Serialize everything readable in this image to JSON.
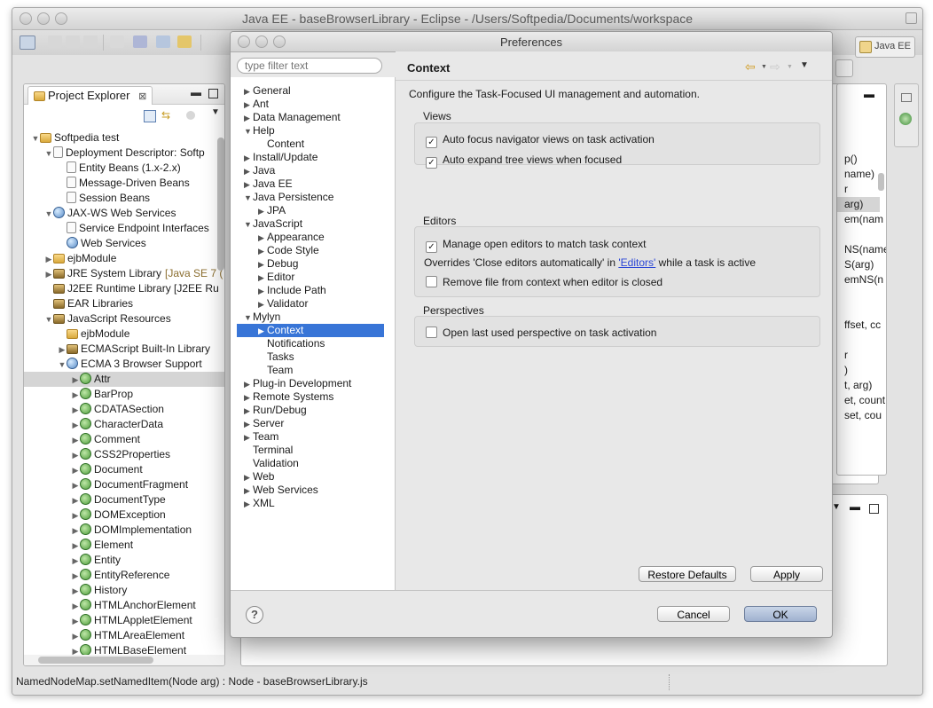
{
  "window": {
    "title": "Java EE - baseBrowserLibrary - Eclipse - /Users/Softpedia/Documents/workspace"
  },
  "perspective": {
    "label": "Java EE"
  },
  "explorer": {
    "tab_label": "Project Explorer",
    "rows": [
      {
        "label": "Softpedia test",
        "icon": "project-icon",
        "expanded": true
      },
      {
        "label": "Deployment Descriptor: Softp",
        "icon": "descriptor-icon",
        "expanded": true
      },
      {
        "label": "Entity Beans (1.x-2.x)",
        "icon": "beans-icon"
      },
      {
        "label": "Message-Driven Beans",
        "icon": "beans-icon"
      },
      {
        "label": "Session Beans",
        "icon": "beans-icon"
      },
      {
        "label": "JAX-WS Web Services",
        "icon": "webservice-icon",
        "expanded": true
      },
      {
        "label": "Service Endpoint Interfaces",
        "icon": "endpoint-icon"
      },
      {
        "label": "Web Services",
        "icon": "webservice-icon"
      },
      {
        "label": "ejbModule",
        "icon": "folder-icon",
        "expanded": false
      },
      {
        "label": "JRE System Library",
        "annotation": "[Java SE 7 (",
        "icon": "library-icon",
        "expanded": false
      },
      {
        "label": "J2EE Runtime Library [J2EE Ru",
        "icon": "library-icon"
      },
      {
        "label": "EAR Libraries",
        "icon": "library-icon"
      },
      {
        "label": "JavaScript Resources",
        "icon": "library-icon",
        "expanded": true
      },
      {
        "label": "ejbModule",
        "icon": "folder-icon"
      },
      {
        "label": "ECMAScript Built-In Library",
        "icon": "library-icon",
        "expanded": false
      },
      {
        "label": "ECMA 3 Browser Support",
        "icon": "globe-icon",
        "expanded": true
      },
      {
        "label": "Attr",
        "icon": "js-class-icon",
        "expanded": false
      },
      {
        "label": "BarProp",
        "icon": "js-class-icon",
        "expanded": false
      },
      {
        "label": "CDATASection",
        "icon": "js-class-icon",
        "expanded": false
      },
      {
        "label": "CharacterData",
        "icon": "js-class-icon",
        "expanded": false
      },
      {
        "label": "Comment",
        "icon": "js-class-icon",
        "expanded": false
      },
      {
        "label": "CSS2Properties",
        "icon": "js-class-icon",
        "expanded": false
      },
      {
        "label": "Document",
        "icon": "js-class-icon",
        "expanded": false
      },
      {
        "label": "DocumentFragment",
        "icon": "js-class-icon",
        "expanded": false
      },
      {
        "label": "DocumentType",
        "icon": "js-class-icon",
        "expanded": false
      },
      {
        "label": "DOMException",
        "icon": "js-class-icon",
        "expanded": false
      },
      {
        "label": "DOMImplementation",
        "icon": "js-class-icon",
        "expanded": false
      },
      {
        "label": "Element",
        "icon": "js-class-icon",
        "expanded": false
      },
      {
        "label": "Entity",
        "icon": "js-class-icon",
        "expanded": false
      },
      {
        "label": "EntityReference",
        "icon": "js-class-icon",
        "expanded": false
      },
      {
        "label": "History",
        "icon": "js-class-icon",
        "expanded": false
      },
      {
        "label": "HTMLAnchorElement",
        "icon": "js-class-icon",
        "expanded": false
      },
      {
        "label": "HTMLAppletElement",
        "icon": "js-class-icon",
        "expanded": false
      },
      {
        "label": "HTMLAreaElement",
        "icon": "js-class-icon",
        "expanded": false
      },
      {
        "label": "HTMLBaseElement",
        "icon": "js-class-icon",
        "expanded": false
      }
    ],
    "selected_label": "Attr"
  },
  "outline": {
    "fragments": [
      "p()",
      "name)",
      "r",
      "arg)",
      "em(nam",
      "",
      "NS(name",
      "S(arg)",
      "emNS(n",
      "",
      "",
      "ffset, cc",
      "",
      "r",
      ")",
      "t, arg)",
      "et, count",
      "set, cou"
    ]
  },
  "status": {
    "text": "NamedNodeMap.setNamedItem(Node arg) : Node - baseBrowserLibrary.js"
  },
  "dialog": {
    "title": "Preferences",
    "filter_placeholder": "type filter text",
    "tree": [
      {
        "label": "General",
        "expander": "collapsed"
      },
      {
        "label": "Ant",
        "expander": "collapsed"
      },
      {
        "label": "Data Management",
        "expander": "collapsed"
      },
      {
        "label": "Help",
        "expander": "expanded"
      },
      {
        "label": "Content",
        "expander": "none"
      },
      {
        "label": "Install/Update",
        "expander": "collapsed"
      },
      {
        "label": "Java",
        "expander": "collapsed"
      },
      {
        "label": "Java EE",
        "expander": "collapsed"
      },
      {
        "label": "Java Persistence",
        "expander": "expanded"
      },
      {
        "label": "JPA",
        "expander": "collapsed"
      },
      {
        "label": "JavaScript",
        "expander": "expanded"
      },
      {
        "label": "Appearance",
        "expander": "collapsed"
      },
      {
        "label": "Code Style",
        "expander": "collapsed"
      },
      {
        "label": "Debug",
        "expander": "collapsed"
      },
      {
        "label": "Editor",
        "expander": "collapsed"
      },
      {
        "label": "Include Path",
        "expander": "collapsed"
      },
      {
        "label": "Validator",
        "expander": "collapsed"
      },
      {
        "label": "Mylyn",
        "expander": "expanded"
      },
      {
        "label": "Context",
        "expander": "collapsed",
        "selected": true
      },
      {
        "label": "Notifications",
        "expander": "none"
      },
      {
        "label": "Tasks",
        "expander": "none"
      },
      {
        "label": "Team",
        "expander": "none"
      },
      {
        "label": "Plug-in Development",
        "expander": "collapsed"
      },
      {
        "label": "Remote Systems",
        "expander": "collapsed"
      },
      {
        "label": "Run/Debug",
        "expander": "collapsed"
      },
      {
        "label": "Server",
        "expander": "collapsed"
      },
      {
        "label": "Team",
        "expander": "collapsed"
      },
      {
        "label": "Terminal",
        "expander": "none"
      },
      {
        "label": "Validation",
        "expander": "none"
      },
      {
        "label": "Web",
        "expander": "collapsed"
      },
      {
        "label": "Web Services",
        "expander": "collapsed"
      },
      {
        "label": "XML",
        "expander": "collapsed"
      }
    ],
    "page": {
      "title": "Context",
      "description": "Configure the Task-Focused UI management and automation.",
      "views": {
        "label": "Views",
        "auto_focus": {
          "label": "Auto focus navigator views on task activation",
          "checked": true
        },
        "auto_expand": {
          "label": "Auto expand tree views when focused",
          "checked": true
        }
      },
      "editors": {
        "label": "Editors",
        "manage_editors": {
          "label": "Manage open editors to match task context",
          "checked": true
        },
        "overrides_prefix": "Overrides 'Close editors automatically' in ",
        "overrides_link": "'Editors'",
        "overrides_suffix": " while a task is active",
        "remove_file": {
          "label": "Remove file from context when editor is closed",
          "checked": false
        }
      },
      "perspectives": {
        "label": "Perspectives",
        "open_last": {
          "label": "Open last used perspective on task activation",
          "checked": false
        }
      },
      "restore_defaults": "Restore Defaults",
      "apply": "Apply"
    },
    "cancel": "Cancel",
    "ok": "OK",
    "help_glyph": "?"
  }
}
